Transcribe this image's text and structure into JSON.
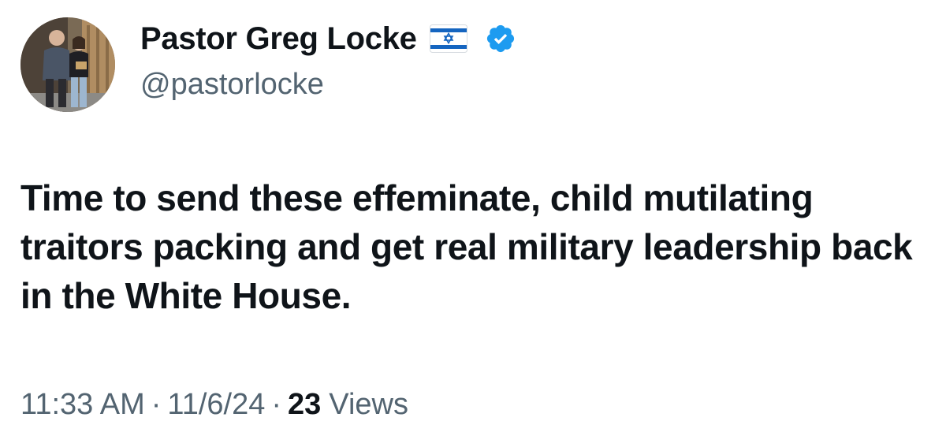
{
  "author": {
    "display_name": "Pastor Greg Locke",
    "handle": "@pastorlocke",
    "flag_icon": "israel-flag-icon",
    "verified_icon": "verified-badge-icon",
    "verified_color": "#1d9bf0",
    "avatar_icon": "profile-photo"
  },
  "tweet": {
    "text": "Time to send these effeminate, child mutilating traitors packing and get real military leadership back in the White House."
  },
  "meta": {
    "time": "11:33 AM",
    "separator": "·",
    "date": "11/6/24",
    "views_count": "23",
    "views_label": "Views"
  },
  "colors": {
    "text_primary": "#0f1419",
    "text_secondary": "#536471"
  }
}
